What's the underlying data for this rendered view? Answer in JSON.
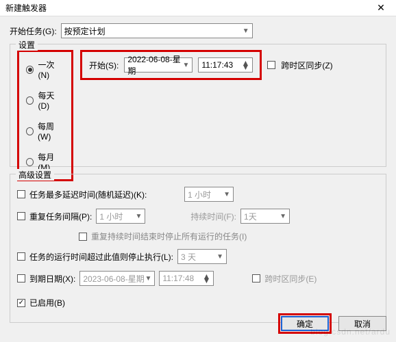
{
  "titlebar": {
    "title": "新建触发器",
    "close": "✕"
  },
  "beginTask": {
    "label": "开始任务(G):",
    "value": "按预定计划"
  },
  "settings": {
    "legend": "设置",
    "radios": [
      {
        "label": "一次(N)",
        "checked": true
      },
      {
        "label": "每天(D)",
        "checked": false
      },
      {
        "label": "每周(W)",
        "checked": false
      },
      {
        "label": "每月(M)",
        "checked": false
      }
    ],
    "start": {
      "label": "开始(S):",
      "date": "2022-06-08-星期",
      "time": "11:17:43"
    },
    "tzSync": {
      "label": "跨时区同步(Z)"
    }
  },
  "advanced": {
    "legend": "高级设置",
    "maxDelay": {
      "label": "任务最多延迟时间(随机延迟)(K):",
      "value": "1 小时"
    },
    "repeat": {
      "label": "重复任务间隔(P):",
      "value": "1 小时",
      "durationLabel": "持续时间(F):",
      "durationValue": "1天"
    },
    "repeatNote": "重复持续时间结束时停止所有运行的任务(I)",
    "stopAfter": {
      "label": "任务的运行时间超过此值则停止执行(L):",
      "value": "3 天"
    },
    "expire": {
      "label": "到期日期(X):",
      "date": "2023-06-08-星期",
      "time": "11:17:48",
      "tzLabel": "跨时区同步(E)"
    },
    "enabled": {
      "label": "已启用(B)",
      "checked": true
    }
  },
  "footer": {
    "ok": "确定",
    "cancel": "取消"
  },
  "watermark": "blog.csdn.net/ardu"
}
